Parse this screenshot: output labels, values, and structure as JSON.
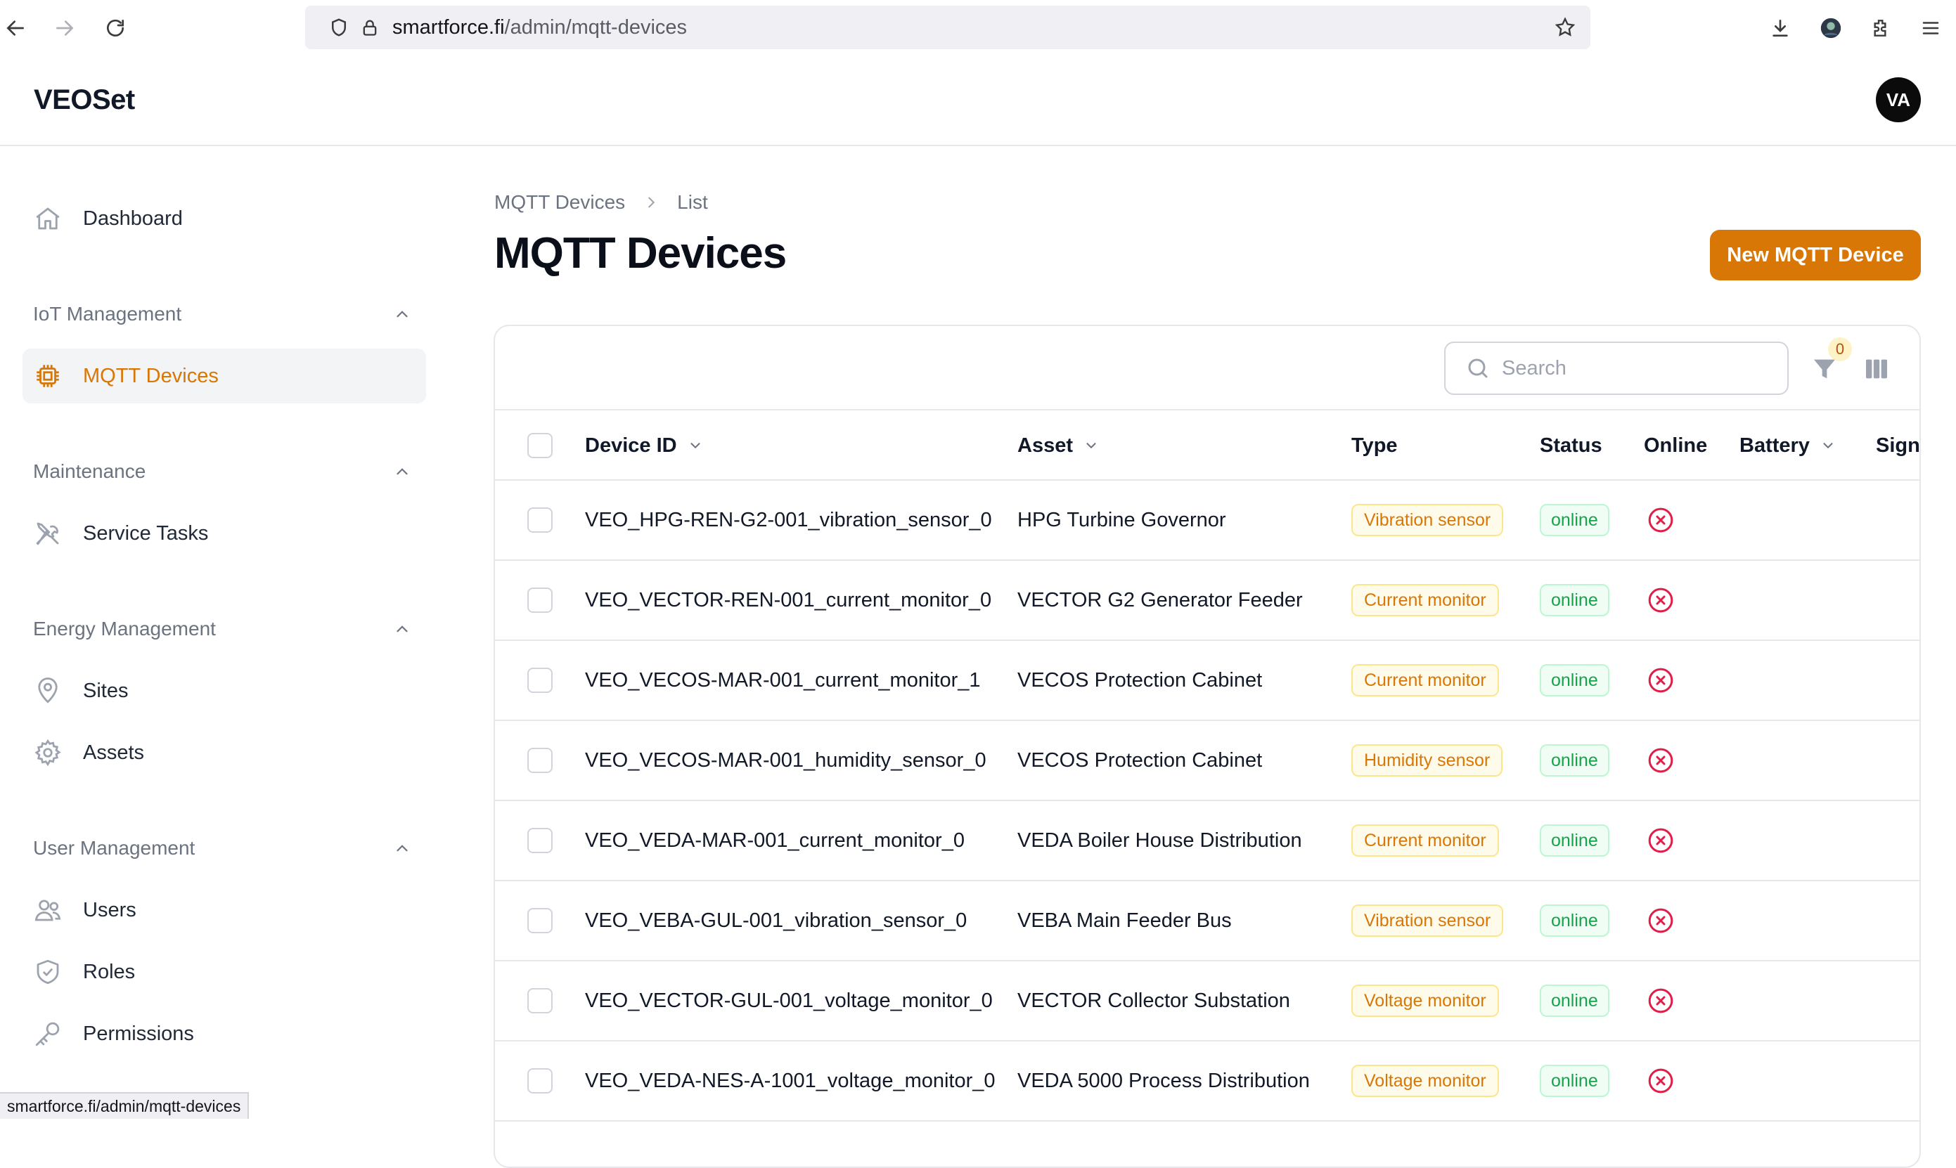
{
  "browser": {
    "url_domain": "smartforce.fi",
    "url_path": "/admin/mqtt-devices",
    "status_url": "smartforce.fi/admin/mqtt-devices"
  },
  "app": {
    "brand": "VEOSet",
    "avatar_initials": "VA"
  },
  "sidebar": {
    "dashboard": "Dashboard",
    "groups": [
      {
        "title": "IoT Management",
        "items": [
          "MQTT Devices"
        ]
      },
      {
        "title": "Maintenance",
        "items": [
          "Service Tasks"
        ]
      },
      {
        "title": "Energy Management",
        "items": [
          "Sites",
          "Assets"
        ]
      },
      {
        "title": "User Management",
        "items": [
          "Users",
          "Roles",
          "Permissions"
        ]
      }
    ],
    "active_item": "MQTT Devices"
  },
  "breadcrumb": {
    "parent": "MQTT Devices",
    "current": "List"
  },
  "page": {
    "title": "MQTT Devices",
    "new_button": "New MQTT Device"
  },
  "toolbar": {
    "search_placeholder": "Search",
    "filter_count": "0"
  },
  "table": {
    "columns": [
      "Device ID",
      "Asset",
      "Type",
      "Status",
      "Online",
      "Battery",
      "Signa"
    ],
    "rows": [
      {
        "device_id": "VEO_HPG-REN-G2-001_vibration_sensor_0",
        "asset": "HPG Turbine Governor",
        "type": "Vibration sensor",
        "status": "online",
        "online": false
      },
      {
        "device_id": "VEO_VECTOR-REN-001_current_monitor_0",
        "asset": "VECTOR G2 Generator Feeder",
        "type": "Current monitor",
        "status": "online",
        "online": false
      },
      {
        "device_id": "VEO_VECOS-MAR-001_current_monitor_1",
        "asset": "VECOS Protection Cabinet",
        "type": "Current monitor",
        "status": "online",
        "online": false
      },
      {
        "device_id": "VEO_VECOS-MAR-001_humidity_sensor_0",
        "asset": "VECOS Protection Cabinet",
        "type": "Humidity sensor",
        "status": "online",
        "online": false
      },
      {
        "device_id": "VEO_VEDA-MAR-001_current_monitor_0",
        "asset": "VEDA Boiler House Distribution",
        "type": "Current monitor",
        "status": "online",
        "online": false
      },
      {
        "device_id": "VEO_VEBA-GUL-001_vibration_sensor_0",
        "asset": "VEBA Main Feeder Bus",
        "type": "Vibration sensor",
        "status": "online",
        "online": false
      },
      {
        "device_id": "VEO_VECTOR-GUL-001_voltage_monitor_0",
        "asset": "VECTOR Collector Substation",
        "type": "Voltage monitor",
        "status": "online",
        "online": false
      },
      {
        "device_id": "VEO_VEDA-NES-A-1001_voltage_monitor_0",
        "asset": "VEDA 5000 Process Distribution",
        "type": "Voltage monitor",
        "status": "online",
        "online": false
      }
    ]
  },
  "colors": {
    "accent": "#d97706",
    "online_green": "#16a34a",
    "offline_red": "#e11d48"
  }
}
